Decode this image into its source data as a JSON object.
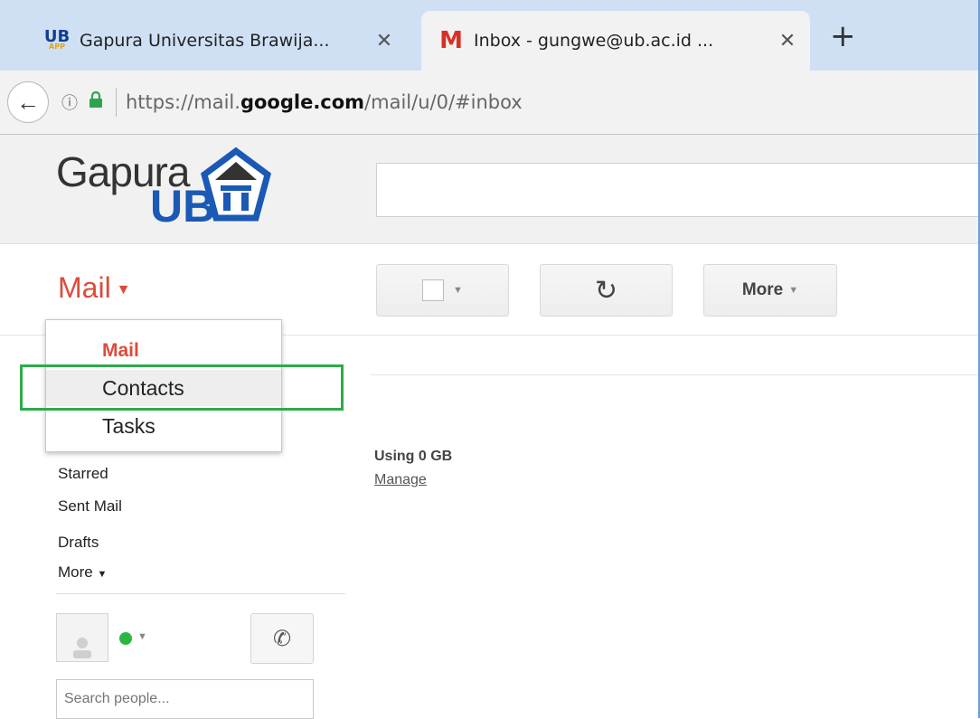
{
  "browser": {
    "tabs": [
      {
        "favicon": "UB",
        "favicon_sub": "APP",
        "title": "Gapura Universitas Brawija...",
        "active": false
      },
      {
        "favicon": "M",
        "title": "Inbox - gungwe@ub.ac.id ...",
        "active": true
      }
    ],
    "new_tab": "+",
    "close": "✕",
    "url": {
      "prefix": "https://mail.",
      "domain": "google.com",
      "path": "/mail/u/0/#inbox"
    }
  },
  "header": {
    "logo_top": "Gapura",
    "logo_bottom": "UB",
    "search_value": ""
  },
  "app_switcher": {
    "current": "Mail",
    "menu": [
      "Mail",
      "Contacts",
      "Tasks"
    ]
  },
  "toolbar": {
    "refresh_icon": "↻",
    "more_label": "More"
  },
  "nav": {
    "items": [
      "Starred",
      "Sent Mail",
      "Drafts"
    ],
    "more_label": "More"
  },
  "storage": {
    "usage": "Using 0 GB",
    "manage": "Manage"
  },
  "people": {
    "search_placeholder": "Search people..."
  },
  "colors": {
    "mail_red": "#dd4b39",
    "highlight_green": "#2eab4a",
    "status_green": "#2cb742",
    "ub_blue": "#1a59b5"
  }
}
